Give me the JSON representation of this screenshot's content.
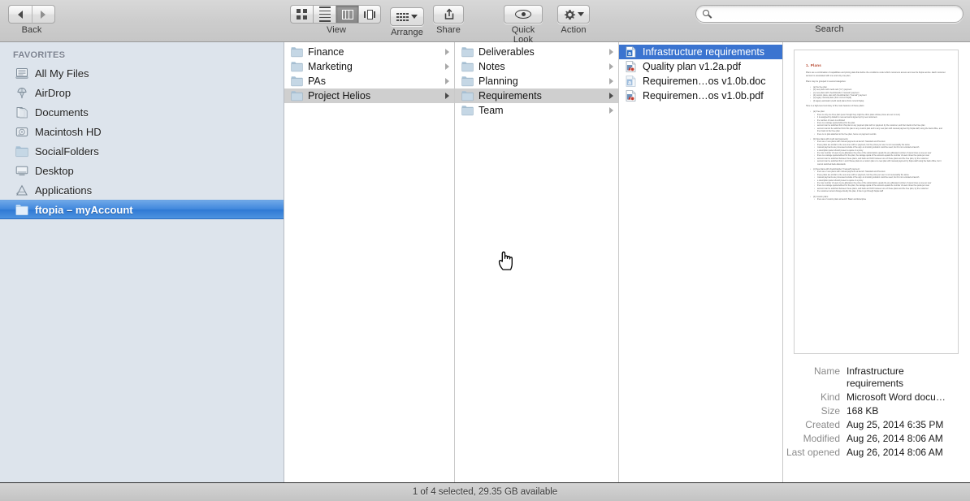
{
  "toolbar": {
    "back_label": "Back",
    "view_label": "View",
    "arrange_label": "Arrange",
    "share_label": "Share",
    "quicklook_label": "Quick Look",
    "action_label": "Action",
    "search_label": "Search",
    "search_value": "",
    "search_placeholder": "",
    "view_modes": [
      {
        "name": "icon-view",
        "active": false
      },
      {
        "name": "list-view",
        "active": false
      },
      {
        "name": "column-view",
        "active": true
      },
      {
        "name": "coverflow-view",
        "active": false
      }
    ]
  },
  "sidebar": {
    "section_title": "FAVORITES",
    "items": [
      {
        "label": "All My Files",
        "icon": "all-my-files-icon",
        "selected": false
      },
      {
        "label": "AirDrop",
        "icon": "airdrop-icon",
        "selected": false
      },
      {
        "label": "Documents",
        "icon": "documents-folder-icon",
        "selected": false
      },
      {
        "label": "Macintosh HD",
        "icon": "hard-disk-icon",
        "selected": false
      },
      {
        "label": "SocialFolders",
        "icon": "folder-icon",
        "selected": false
      },
      {
        "label": "Desktop",
        "icon": "desktop-icon",
        "selected": false
      },
      {
        "label": "Applications",
        "icon": "applications-icon",
        "selected": false
      },
      {
        "label": "ftopia – myAccount",
        "icon": "folder-icon",
        "selected": true
      }
    ]
  },
  "columns": [
    {
      "name": "column-1",
      "rows": [
        {
          "label": "Finance",
          "kind": "folder",
          "selected": false,
          "has_arrow": true
        },
        {
          "label": "Marketing",
          "kind": "folder",
          "selected": false,
          "has_arrow": true
        },
        {
          "label": "PAs",
          "kind": "folder",
          "selected": false,
          "has_arrow": true
        },
        {
          "label": "Project Helios",
          "kind": "folder",
          "selected": "gray",
          "has_arrow": true
        }
      ]
    },
    {
      "name": "column-2",
      "rows": [
        {
          "label": "Deliverables",
          "kind": "folder",
          "selected": false,
          "has_arrow": true
        },
        {
          "label": "Notes",
          "kind": "folder",
          "selected": false,
          "has_arrow": true
        },
        {
          "label": "Planning",
          "kind": "folder",
          "selected": false,
          "has_arrow": true
        },
        {
          "label": "Requirements",
          "kind": "folder",
          "selected": "gray",
          "has_arrow": true
        },
        {
          "label": "Team",
          "kind": "folder",
          "selected": false,
          "has_arrow": true
        }
      ]
    },
    {
      "name": "column-3",
      "rows": [
        {
          "label": "Infrastructure requirements",
          "kind": "doc",
          "selected": "blue",
          "has_arrow": false
        },
        {
          "label": "Quality plan v1.2a.pdf",
          "kind": "pdf",
          "selected": false,
          "has_arrow": false
        },
        {
          "label": "Requiremen…os v1.0b.doc",
          "kind": "doc-dim",
          "selected": false,
          "has_arrow": false
        },
        {
          "label": "Requiremen…os v1.0b.pdf",
          "kind": "pdf",
          "selected": false,
          "has_arrow": false
        }
      ]
    }
  ],
  "preview": {
    "thumbnail": {
      "heading": "1. Plans",
      "paragraphs": [
        "Plans are a combination of capabilities and pricing data that define the conditions under which customers access and use the ftopia service. Each customer account is associated with one and only one plan.",
        "Plans may be grouped in several categories:",
        "Here is a high-level summary of the main features of these plans:"
      ],
      "list_a": [
        "(a) the free plan",
        "(b) new plans with credit card (\"cc\") payment",
        "(c) new plans with check/transfer (\"manual\") payment",
        "(d) custom plans, also with check/transfer (\"manual\") payment",
        "(e) legacy manual plans (from current ftopia)",
        "(f) legacy automatic (credit card) plans (from current ftopia)"
      ],
      "section_free": "(a) Free plan:",
      "free_items": [
        "there is only one Free plan (even though they might be other plans whose prices are set to zero)",
        "it is assigned by default to new accounts signed up by new customers",
        "the number of users is unlimited",
        "there is a storage quota defined for the plan",
        "account can be switched from this plan to any payment plan with cc payment by the customer, and then back to the Free plan",
        "account cannot be switched from this plan to any custom plan and to any new plan with manual payment by ftopia staff, using the back office, and then back to the Free plan",
        "there is no plan attached to the free plan, hence no payment records"
      ],
      "section_new_cc": "(b) New plans with credit card payments:",
      "new_cc_items": [
        "there are 2 new plans with manual payments at launch: Standard and Premium",
        "these plans are similar to the new ones with cc payment, but the prices per user is not necessarily the same",
        "manual payments are processed outside of the app: an invoicing solution could be used, but it's not recorded at launch",
        "a description panel should present a quote or a proxy",
        "the max number of users is pre-allocated, the price of the subscription equals the pre-allocated number of users times a one per user",
        "there is a storage quota defined for the plan, the storage quota of the account equals the number of users times the quota per user",
        "account can be switched between these plans, and back and forth between one of these plans and the free plan, by the customer",
        "account can be switched from / and if these plans to a custom plan or a new plan with manual payment by ftopia staff using the back office, but it cannot switched back afterwards"
      ],
      "section_manual": "(c) New plans with check/transfer (\"manual\") payment:",
      "manual_items": [
        "there are 2 new plans with manual payments at launch: Standard and Premium",
        "these plans are similar to the new ones with cc payment, but the price per user is not necessarily the same",
        "manual payments are processed outside of the app: an invoicing solution could be used, but it's not recorded at launch",
        "a description panel should present a quote or a proxy",
        "the max number of users is pre-allocated, the price of the subscription equals the pre-allocated number of users times a one per user",
        "there is a storage quota defined for the plan, the storage quota of the account equals the number of users times the quota per user",
        "account can be switched between these plans, and back and forth between one of these plans and the free plan, by the customer",
        "the customer cannot change directly the plan, it has to go through ftopia staff"
      ],
      "section_custom": "(d) Custom plans:",
      "custom_items": [
        "there are 2 custom plans at launch: Basic and Enterprise"
      ]
    },
    "info": {
      "rows": [
        {
          "key": "Name",
          "value": "Infrastructure requirements"
        },
        {
          "key": "Kind",
          "value": "Microsoft Word docu…"
        },
        {
          "key": "Size",
          "value": "168 KB"
        },
        {
          "key": "Created",
          "value": "Aug 25, 2014 6:35 PM"
        },
        {
          "key": "Modified",
          "value": "Aug 26, 2014 8:06 AM"
        },
        {
          "key": "Last opened",
          "value": "Aug 26, 2014 8:06 AM"
        }
      ]
    }
  },
  "statusbar": {
    "text": "1 of 4 selected, 29.35 GB available"
  },
  "colors": {
    "selection_blue": "#3b74d0",
    "sidebar_bg": "#dde4ec",
    "toolbar_bg": "#cdcdcd",
    "heading_red": "#b5432a"
  }
}
